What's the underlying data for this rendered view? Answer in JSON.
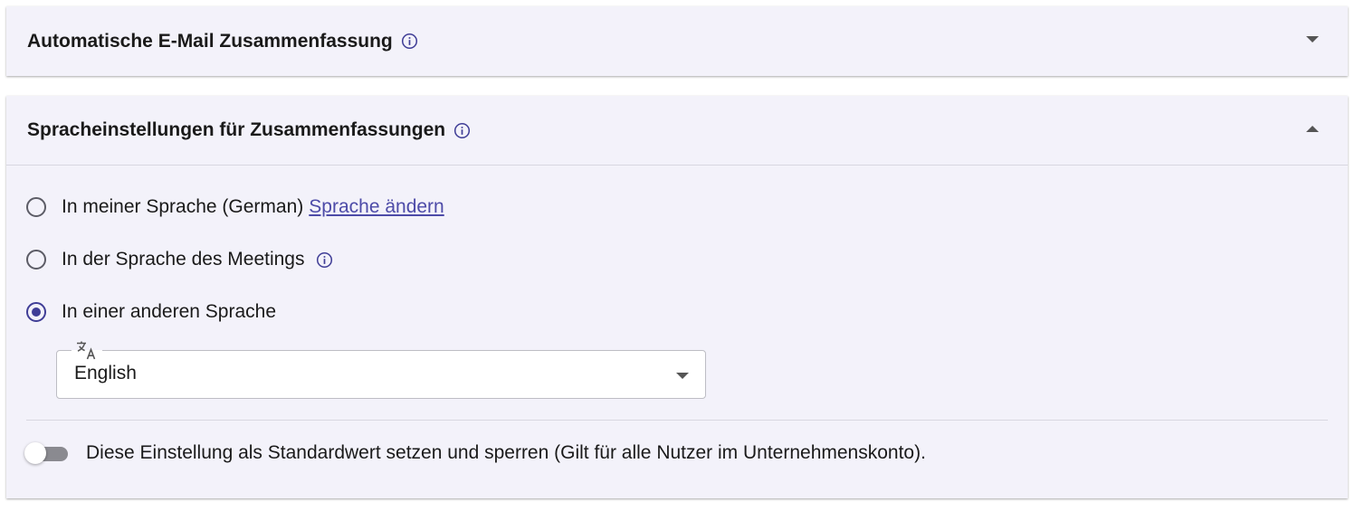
{
  "sections": [
    {
      "title": "Automatische E-Mail Zusammenfassung",
      "expanded": false
    },
    {
      "title": "Spracheinstellungen für Zusammenfassungen",
      "expanded": true
    }
  ],
  "language_options": {
    "option_my_language": "In meiner Sprache (German)",
    "change_language_link": "Sprache ändern",
    "option_meeting_language": "In der Sprache des Meetings",
    "option_other_language": "In einer anderen Sprache",
    "selected_option": "option_other_language"
  },
  "language_select": {
    "icon": "translate-icon",
    "value": "English"
  },
  "default_toggle": {
    "label": "Diese Einstellung als Standardwert setzen und sperren (Gilt für alle Nutzer im Unternehmenskonto).",
    "enabled": false
  },
  "colors": {
    "accent": "#3f3d96",
    "link": "#4d4ba8",
    "panel_background": "#f3f2fa"
  }
}
